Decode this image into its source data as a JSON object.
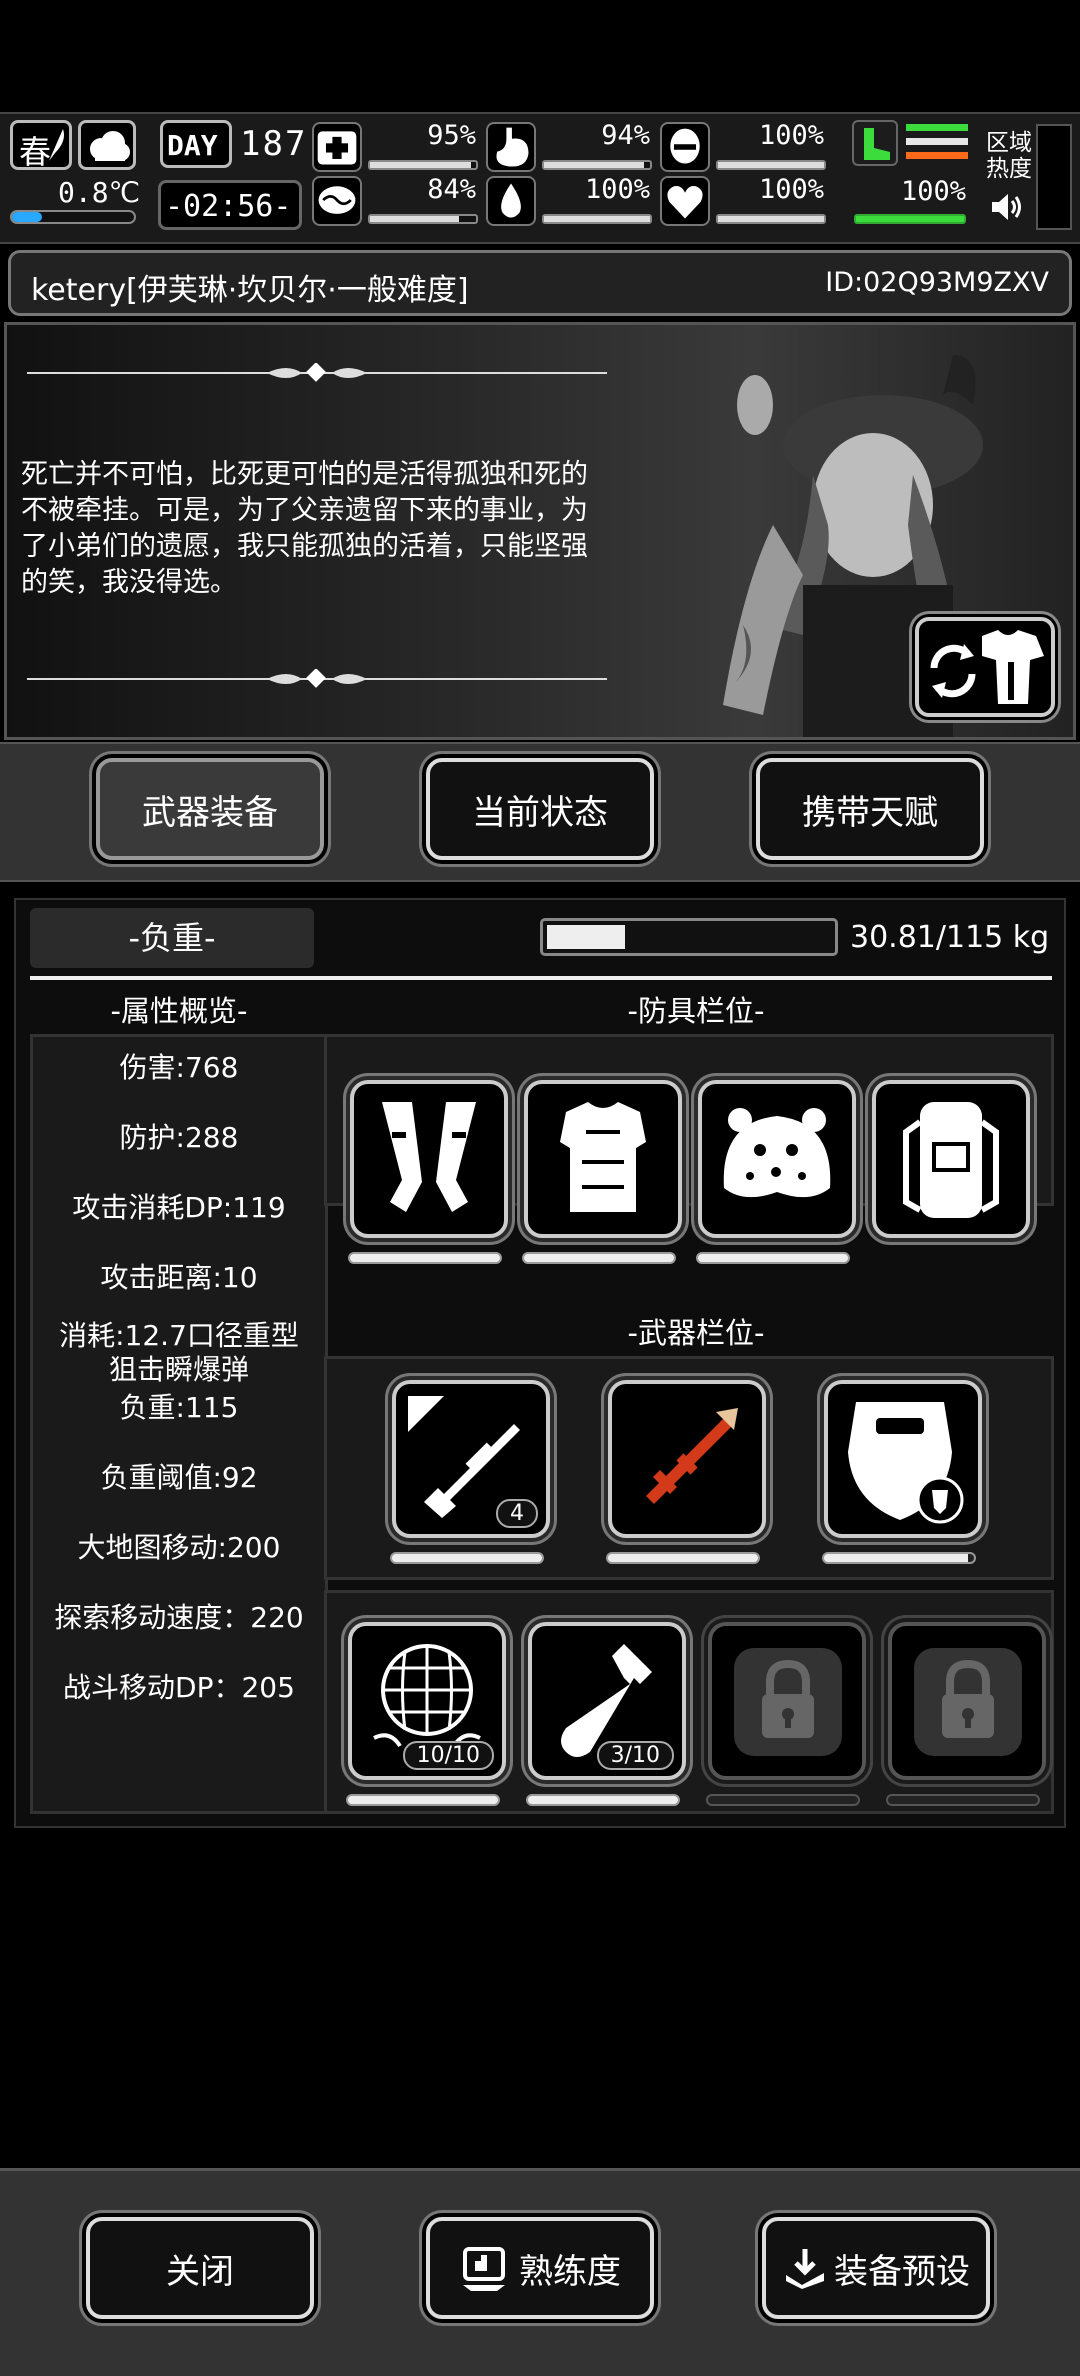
{
  "hud": {
    "season": "春",
    "temperature": "0.8℃",
    "day_label": "DAY",
    "day": "187",
    "clock": "-02:56-",
    "stats": [
      {
        "name": "health",
        "icon": "first-aid-icon",
        "value": "95%",
        "level": 0.95
      },
      {
        "name": "hunger",
        "icon": "stomach-icon",
        "value": "94%",
        "level": 0.94
      },
      {
        "name": "armor",
        "icon": "helmet-icon",
        "value": "100%",
        "level": 1.0
      },
      {
        "name": "sanity",
        "icon": "brain-icon",
        "value": "84%",
        "level": 0.84
      },
      {
        "name": "thirst",
        "icon": "water-drop-icon",
        "value": "100%",
        "level": 1.0
      },
      {
        "name": "mood",
        "icon": "heart-icon",
        "value": "100%",
        "level": 1.0
      }
    ],
    "stamina": {
      "icon": "boot-icon",
      "value": "100%",
      "level": 1.0
    },
    "region_heat": "区域热度"
  },
  "player": {
    "name": "ketery[伊芙琳·坎贝尔·一般难度]",
    "id": "ID:02Q93M9ZXV"
  },
  "story": {
    "quote": "死亡并不可怕，比死更可怕的是活得孤独和死的不被牵挂。可是，为了父亲遗留下来的事业，为了小弟们的遗愿，我只能孤独的活着，只能坚强的笑，我没得选。"
  },
  "tabs": [
    "武器装备",
    "当前状态",
    "携带天赋"
  ],
  "equip": {
    "weight_label": "-负重-",
    "weight_text": "30.81/115 kg",
    "weight_level": 0.268,
    "attr_title": "-属性概览-",
    "armor_title": "-防具栏位-",
    "weapon_title": "-武器栏位-",
    "attributes": [
      "伤害:768",
      "防护:288",
      "攻击消耗DP:119",
      "攻击距离:10",
      "消耗:12.7口径重型狙击瞬爆弹",
      "负重:115",
      "负重阈值:92",
      "大地图移动:200",
      "探索移动速度：220",
      "战斗移动DP：205"
    ],
    "armor_slots": [
      {
        "icon": "gauntlet-icon",
        "durability": 1.0
      },
      {
        "icon": "body-armor-icon",
        "durability": 1.0
      },
      {
        "icon": "leopard-hat-icon",
        "durability": 1.0
      },
      {
        "icon": "backpack-icon",
        "durability": null
      }
    ],
    "weapon_slots": [
      {
        "icon": "sniper-rifle-icon",
        "count": "4",
        "durability": 1.0
      },
      {
        "icon": "rocket-launcher-icon",
        "durability": 1.0
      },
      {
        "icon": "riot-shield-icon",
        "durability": 0.96
      }
    ],
    "tool_slots": [
      {
        "icon": "net-icon",
        "count": "10/10",
        "durability": 1.0
      },
      {
        "icon": "flask-icon",
        "count": "3/10",
        "durability": 1.0
      },
      {
        "icon": "lock-icon",
        "locked": true
      },
      {
        "icon": "lock-icon",
        "locked": true
      }
    ]
  },
  "footer": {
    "close": "关闭",
    "proficiency": "熟练度",
    "preset": "装备预设"
  }
}
